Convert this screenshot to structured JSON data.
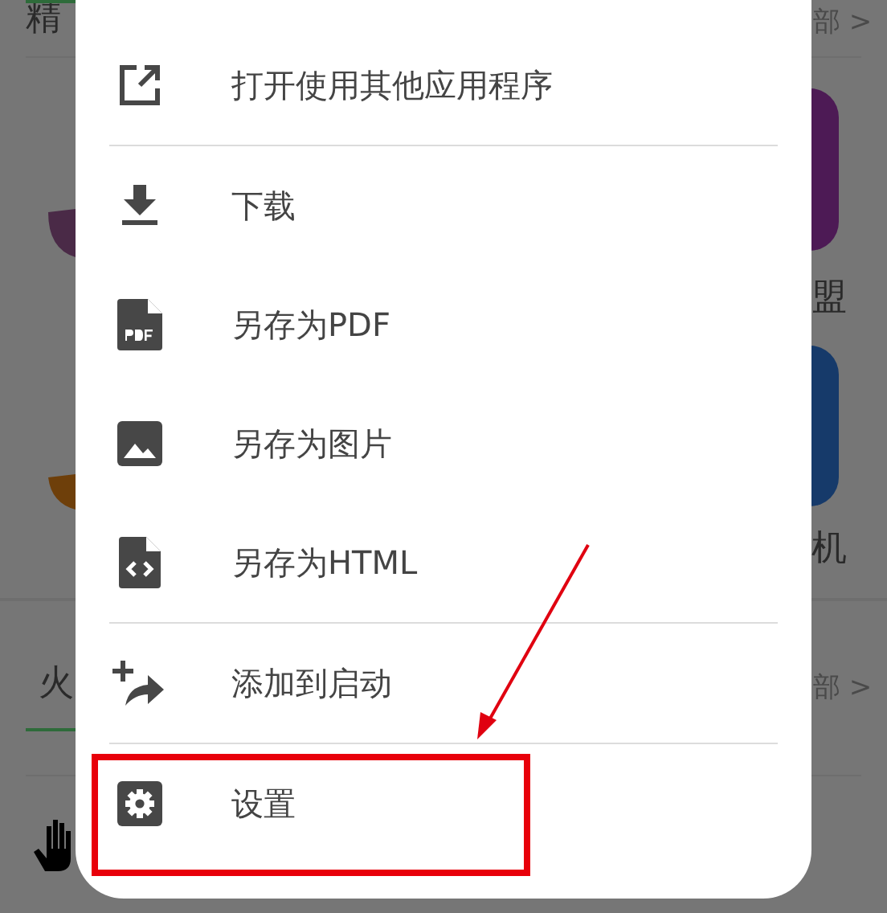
{
  "background": {
    "sections": [
      {
        "title": "精",
        "more": "部 >"
      },
      {
        "title": "火",
        "more": "部 >"
      }
    ],
    "tile_labels": [
      "盟",
      "机"
    ]
  },
  "menu": {
    "groups": [
      {
        "items": [
          {
            "label": "打开使用其他应用程序",
            "highlighted": false
          }
        ]
      },
      {
        "items": [
          {
            "label": "下载",
            "highlighted": false
          },
          {
            "label": "另存为PDF",
            "highlighted": false
          },
          {
            "label": "另存为图片",
            "highlighted": false
          },
          {
            "label": "另存为HTML",
            "highlighted": false
          }
        ]
      },
      {
        "items": [
          {
            "label": "添加到启动",
            "highlighted": false
          }
        ]
      },
      {
        "items": [
          {
            "label": "设置",
            "highlighted": true
          }
        ]
      }
    ]
  }
}
